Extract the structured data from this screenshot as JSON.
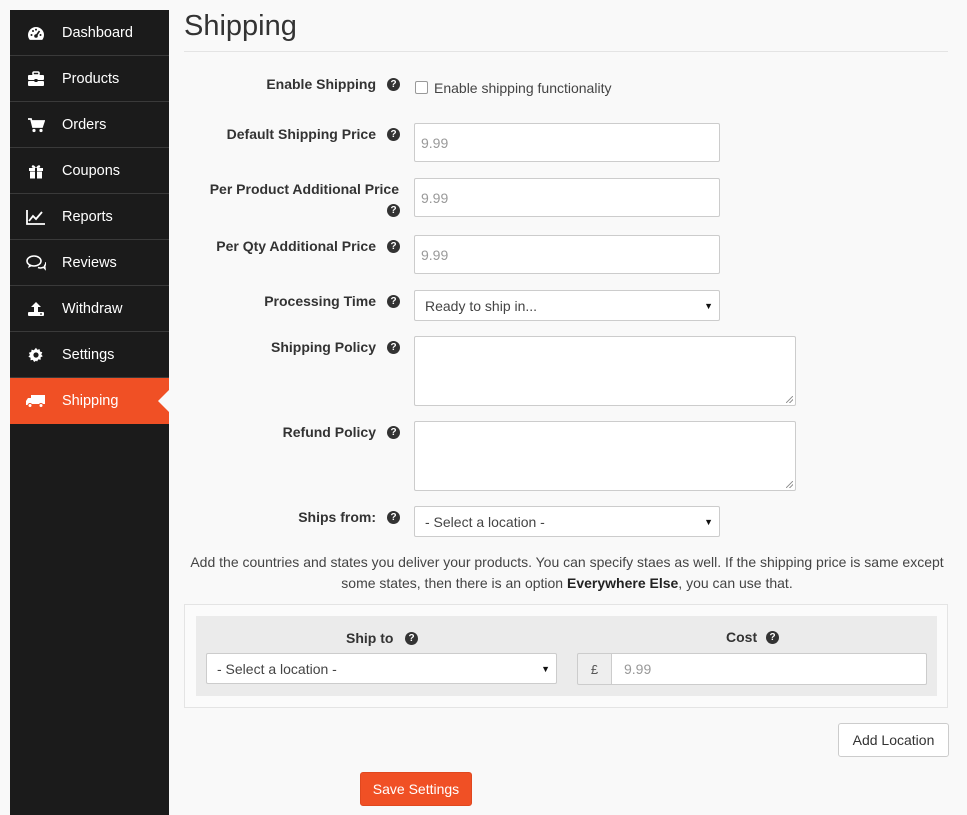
{
  "sidebar": {
    "items": [
      {
        "label": "Dashboard",
        "icon": "dashboard-icon"
      },
      {
        "label": "Products",
        "icon": "briefcase-icon"
      },
      {
        "label": "Orders",
        "icon": "cart-icon"
      },
      {
        "label": "Coupons",
        "icon": "gift-icon"
      },
      {
        "label": "Reports",
        "icon": "chart-line-icon"
      },
      {
        "label": "Reviews",
        "icon": "comments-icon"
      },
      {
        "label": "Withdraw",
        "icon": "upload-icon"
      },
      {
        "label": "Settings",
        "icon": "gear-icon"
      },
      {
        "label": "Shipping",
        "icon": "truck-icon",
        "active": true
      }
    ]
  },
  "page": {
    "title": "Shipping"
  },
  "form": {
    "enable_shipping": {
      "label": "Enable Shipping",
      "checkbox_label": "Enable shipping functionality",
      "checked": false
    },
    "default_price": {
      "label": "Default Shipping Price",
      "placeholder": "9.99"
    },
    "per_product": {
      "label_line1": "Per Product Additional Price",
      "placeholder": "9.99"
    },
    "per_qty": {
      "label": "Per Qty Additional Price",
      "placeholder": "9.99"
    },
    "processing_time": {
      "label": "Processing Time",
      "selected": "Ready to ship in..."
    },
    "shipping_policy": {
      "label": "Shipping Policy"
    },
    "refund_policy": {
      "label": "Refund Policy"
    },
    "ships_from": {
      "label": "Ships from:",
      "selected": "- Select a location -"
    }
  },
  "info": {
    "text_before": "Add the countries and states you deliver your products. You can specify staes as well. If the shipping price is same except some states, then there is an option ",
    "bold": "Everywhere Else",
    "text_after": ", you can use that."
  },
  "ship_table": {
    "ship_to_header": "Ship to",
    "cost_header": "Cost",
    "ship_to_selected": "- Select a location -",
    "currency_symbol": "£",
    "cost_placeholder": "9.99"
  },
  "buttons": {
    "add_location": "Add Location",
    "save_settings": "Save Settings"
  },
  "colors": {
    "accent": "#f05025",
    "sidebar_bg": "#1b1b1b"
  }
}
